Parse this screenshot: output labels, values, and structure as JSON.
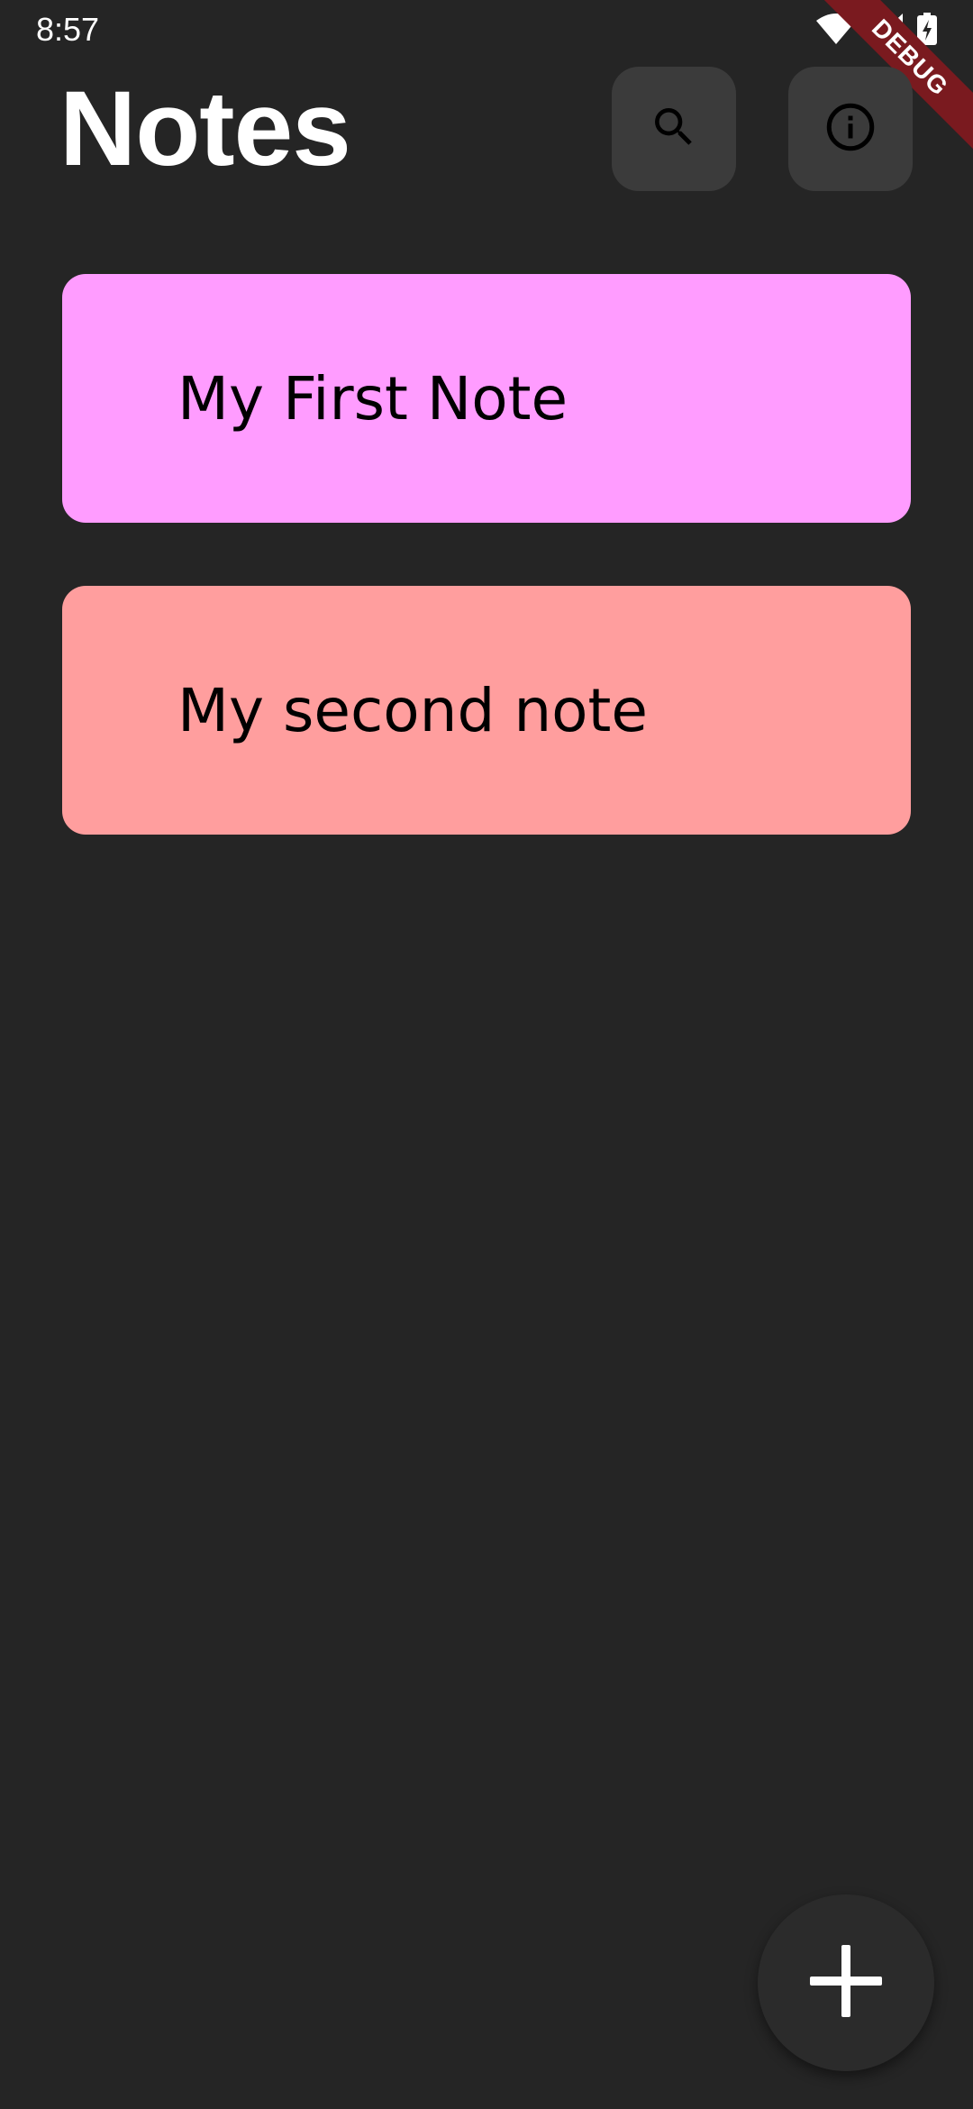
{
  "status_bar": {
    "time": "8:57",
    "icons": [
      "wifi-icon",
      "signal-icon",
      "battery-charging-icon"
    ]
  },
  "debug_banner": {
    "label": "DEBUG",
    "color": "#7a1a1f"
  },
  "header": {
    "title": "Notes",
    "actions": [
      {
        "name": "search-button",
        "icon": "search-icon"
      },
      {
        "name": "info-button",
        "icon": "info-icon"
      }
    ]
  },
  "notes": [
    {
      "title": "My First Note",
      "color": "#ff9cff"
    },
    {
      "title": "My second note",
      "color": "#ff9e9e"
    }
  ],
  "fab": {
    "icon": "add-icon"
  },
  "theme": {
    "background": "#252525",
    "button_background": "#3b3b3b",
    "fab_background": "#2b2b2b"
  }
}
